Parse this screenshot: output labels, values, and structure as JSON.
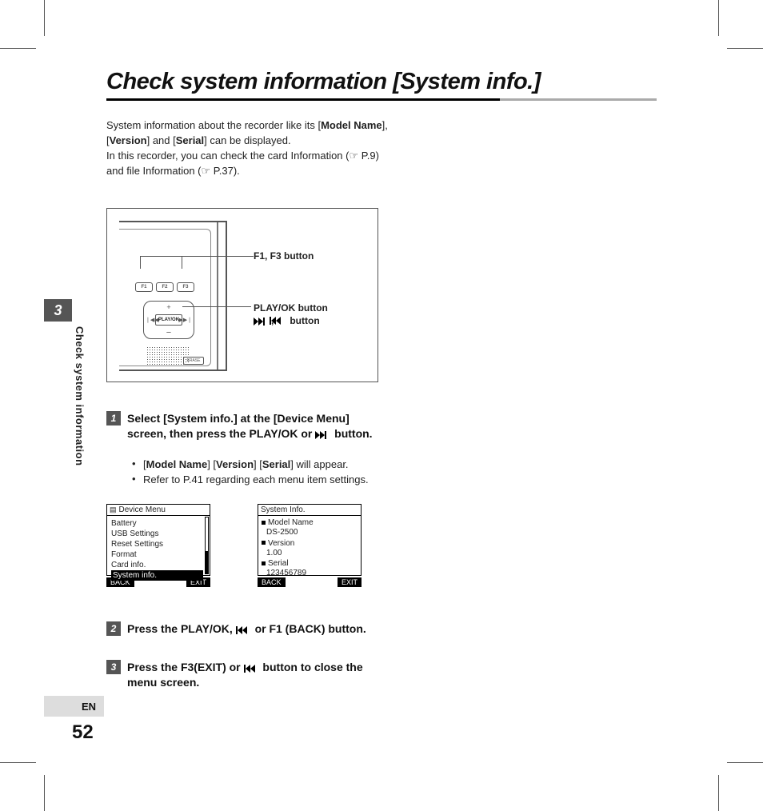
{
  "side": {
    "chapter_number": "3",
    "side_title": "Check system information",
    "language": "EN",
    "page_number": "52"
  },
  "title": "Check system information [System info.]",
  "intro_parts": {
    "p1a": "System information about the recorder like its [",
    "p1b": "Model Name",
    "p1c": "], [",
    "p1d": "Version",
    "p1e": "] and [",
    "p1f": "Serial",
    "p1g": "] can be displayed.",
    "p2": "In this recorder, you can check the card Information (☞ P.9) and file Information (☞ P.37)."
  },
  "device_labels": {
    "f1_f3": "F1, F3 button",
    "playok": "PLAY/OK button",
    "ffrw": ",      button",
    "f1": "F1",
    "f2": "F2",
    "f3": "F3",
    "playok_btn": "PLAY/OK",
    "erase": "ERASE"
  },
  "steps": {
    "s1_num": "1",
    "s1_a": "Select [",
    "s1_b": "System info.",
    "s1_c": "] at the [",
    "s1_d": "Device Menu",
    "s1_e": "] screen, then press the ",
    "s1_f": "PLAY/OK",
    "s1_g": " or ",
    "s1_h": " button.",
    "bullet1_a": "[",
    "bullet1_b": "Model Name",
    "bullet1_c": "] [",
    "bullet1_d": "Version",
    "bullet1_e": "] [",
    "bullet1_f": "Serial",
    "bullet1_g": "] will appear.",
    "bullet2": "Refer to P.41 regarding each menu item settings.",
    "s2_num": "2",
    "s2_a": "Press the ",
    "s2_b": "PLAY/OK",
    "s2_c": ", ",
    "s2_d": " or ",
    "s2_e": "F1",
    "s2_f": " (",
    "s2_g": "BACK",
    "s2_h": ") button.",
    "s3_num": "3",
    "s3_a": "Press the ",
    "s3_b": "F3",
    "s3_c": "(",
    "s3_d": "EXIT",
    "s3_e": ") or ",
    "s3_f": " button to close the menu screen."
  },
  "menu_left": {
    "title": "Device Menu",
    "items": [
      "Battery",
      "USB Settings",
      "Reset Settings",
      "Format",
      "Card info."
    ],
    "selected": "System info.",
    "sk_left": "BACK",
    "sk_right": "EXIT"
  },
  "menu_right": {
    "title": "System Info.",
    "fields": [
      {
        "label": "Model Name",
        "value": "DS-2500"
      },
      {
        "label": "Version",
        "value": "1.00"
      },
      {
        "label": "Serial",
        "value": "123456789"
      }
    ],
    "sk_left": "BACK",
    "sk_right": "EXIT"
  }
}
